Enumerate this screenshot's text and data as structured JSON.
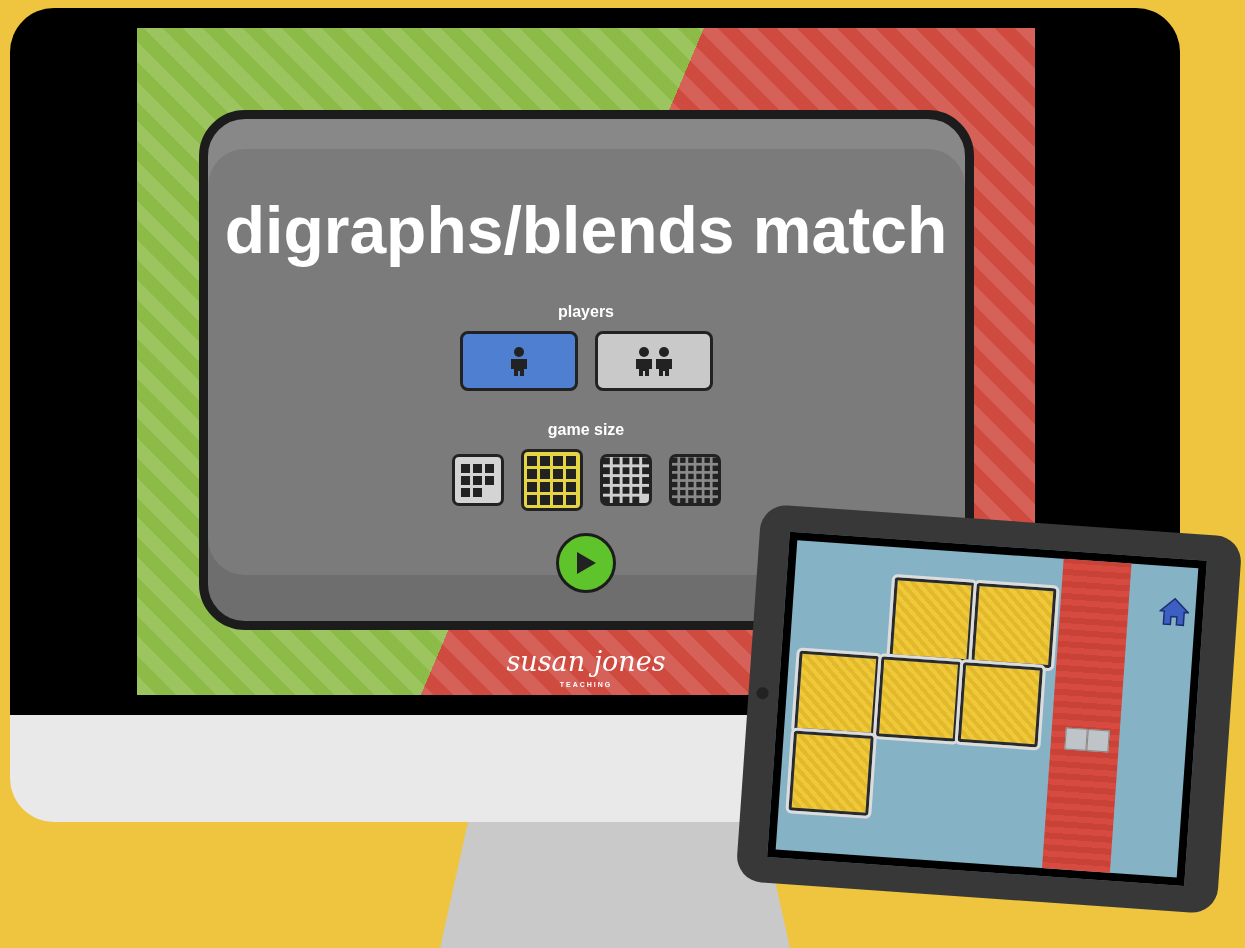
{
  "title": "digraphs/blends match",
  "players": {
    "label": "players",
    "options": [
      {
        "kind": "one",
        "selected": true
      },
      {
        "kind": "two",
        "selected": false
      }
    ]
  },
  "game_size": {
    "label": "game size",
    "options": [
      {
        "kind": "eight",
        "selected": false
      },
      {
        "kind": "sixteen",
        "selected": true
      },
      {
        "kind": "twentyfour",
        "selected": false
      },
      {
        "kind": "thirtysix",
        "selected": false
      }
    ]
  },
  "brand": {
    "name": "susan jones",
    "tagline": "TEACHING"
  }
}
